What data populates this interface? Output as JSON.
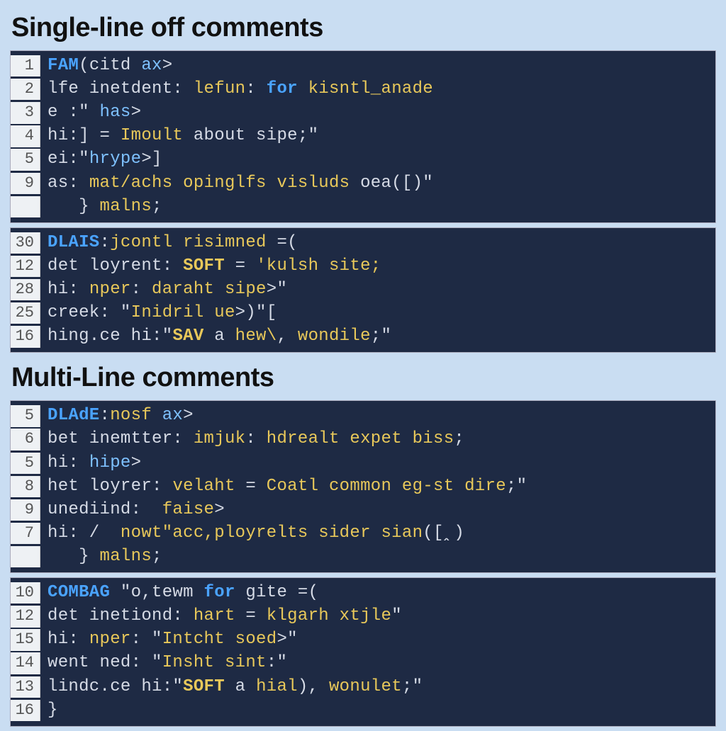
{
  "headings": {
    "h1": "Single-line off comments",
    "h2": "Multi-Line comments"
  },
  "block1": {
    "lines": [
      {
        "num": "1",
        "tokens": [
          [
            "kw",
            "FAM"
          ],
          [
            "op",
            "("
          ],
          [
            "id",
            "citd "
          ],
          [
            "type",
            "ax"
          ],
          [
            "op",
            ">"
          ]
        ]
      },
      {
        "num": "2",
        "tokens": [
          [
            "id",
            "lfe inetdent: "
          ],
          [
            "fn",
            "lefun"
          ],
          [
            "id",
            ": "
          ],
          [
            "kw",
            "for"
          ],
          [
            "id",
            " "
          ],
          [
            "fn",
            "kisntl_anade"
          ]
        ]
      },
      {
        "num": "3",
        "tokens": [
          [
            "id",
            "e :\" "
          ],
          [
            "type",
            "has"
          ],
          [
            "op",
            ">"
          ]
        ]
      },
      {
        "num": "4",
        "tokens": [
          [
            "id",
            "hi:] = "
          ],
          [
            "fn",
            "Imoult"
          ],
          [
            "id",
            " about sipe;\""
          ]
        ]
      },
      {
        "num": "5",
        "tokens": [
          [
            "id",
            "ei:\""
          ],
          [
            "type",
            "hrype"
          ],
          [
            "op",
            ">"
          ],
          [
            "id",
            "]"
          ]
        ]
      },
      {
        "num": "9",
        "tokens": [
          [
            "id",
            "as: "
          ],
          [
            "fn",
            "mat/achs opinglfs visluds"
          ],
          [
            "id",
            " oea([)\""
          ]
        ]
      },
      {
        "num": "",
        "tokens": [
          [
            "id",
            "   } "
          ],
          [
            "fn",
            "malns"
          ],
          [
            "id",
            ";"
          ]
        ]
      }
    ]
  },
  "block2": {
    "lines": [
      {
        "num": "30",
        "tokens": [
          [
            "kw",
            "DLAIS"
          ],
          [
            "id",
            ":"
          ],
          [
            "fn",
            "jcontl risimned "
          ],
          [
            "op",
            "=("
          ]
        ]
      },
      {
        "num": "12",
        "tokens": [
          [
            "id",
            "det loyrent: "
          ],
          [
            "kw2",
            "SOFT"
          ],
          [
            "id",
            " = "
          ],
          [
            "str",
            "'kulsh site;"
          ]
        ]
      },
      {
        "num": "28",
        "tokens": [
          [
            "id",
            "hi: "
          ],
          [
            "fn",
            "nper"
          ],
          [
            "id",
            ": "
          ],
          [
            "str",
            "daraht sipe"
          ],
          [
            "op",
            ">"
          ],
          [
            "id",
            "\""
          ]
        ]
      },
      {
        "num": "25",
        "tokens": [
          [
            "id",
            "creek: \""
          ],
          [
            "fn",
            "Inidril ue"
          ],
          [
            "op",
            ">"
          ],
          [
            "id",
            ")\"["
          ]
        ]
      },
      {
        "num": "16",
        "tokens": [
          [
            "id",
            "hing.ce hi:\""
          ],
          [
            "kw2",
            "SAV"
          ],
          [
            "id",
            " a "
          ],
          [
            "fn",
            "hew\\"
          ],
          [
            "id",
            ", "
          ],
          [
            "fn",
            "wondile"
          ],
          [
            "id",
            ";\""
          ]
        ]
      }
    ]
  },
  "block3": {
    "lines": [
      {
        "num": "5",
        "tokens": [
          [
            "kw",
            "DLAdE"
          ],
          [
            "id",
            ":"
          ],
          [
            "fn",
            "nosf "
          ],
          [
            "type",
            "ax"
          ],
          [
            "op",
            ">"
          ]
        ]
      },
      {
        "num": "6",
        "tokens": [
          [
            "id",
            "bet inemtter: "
          ],
          [
            "fn",
            "imjuk"
          ],
          [
            "id",
            ": "
          ],
          [
            "fn",
            "hdrealt expet biss"
          ],
          [
            "id",
            ";"
          ]
        ]
      },
      {
        "num": "5",
        "tokens": [
          [
            "id",
            "hi: "
          ],
          [
            "type",
            "hipe"
          ],
          [
            "op",
            ">"
          ]
        ]
      },
      {
        "num": "8",
        "tokens": [
          [
            "id",
            "het loyrer: "
          ],
          [
            "fn",
            "velaht"
          ],
          [
            "id",
            " = "
          ],
          [
            "fn",
            "Coatl common eg-st dire"
          ],
          [
            "id",
            ";\""
          ]
        ]
      },
      {
        "num": "9",
        "tokens": [
          [
            "id",
            "unediind:  "
          ],
          [
            "fn",
            "faise"
          ],
          [
            "op",
            ">"
          ]
        ]
      },
      {
        "num": "7",
        "tokens": [
          [
            "id",
            "hi: /  "
          ],
          [
            "fn",
            "nowt\"acc,ployrelts sider sian"
          ],
          [
            "id",
            "([ꞈ)"
          ]
        ]
      },
      {
        "num": "",
        "tokens": [
          [
            "id",
            "   } "
          ],
          [
            "fn",
            "malns"
          ],
          [
            "id",
            ";"
          ]
        ]
      }
    ]
  },
  "block4": {
    "lines": [
      {
        "num": "10",
        "tokens": [
          [
            "kw",
            "COMBAG"
          ],
          [
            "id",
            " \"o,tewm "
          ],
          [
            "kw",
            "for"
          ],
          [
            "id",
            " gite "
          ],
          [
            "op",
            "=("
          ]
        ]
      },
      {
        "num": "12",
        "tokens": [
          [
            "id",
            "det inetiond: "
          ],
          [
            "fn",
            "hart"
          ],
          [
            "id",
            " = "
          ],
          [
            "fn",
            "klgarh xtjle"
          ],
          [
            "id",
            "\""
          ]
        ]
      },
      {
        "num": "15",
        "tokens": [
          [
            "id",
            "hi: "
          ],
          [
            "fn",
            "nper"
          ],
          [
            "id",
            ": \""
          ],
          [
            "fn",
            "Intcht soed"
          ],
          [
            "op",
            ">"
          ],
          [
            "id",
            "\""
          ]
        ]
      },
      {
        "num": "14",
        "tokens": [
          [
            "id",
            "went ned: \""
          ],
          [
            "fn",
            "Insht sint"
          ],
          [
            "id",
            ":\""
          ]
        ]
      },
      {
        "num": "13",
        "tokens": [
          [
            "id",
            "lindc.ce hi:\""
          ],
          [
            "kw2",
            "SOFT"
          ],
          [
            "id",
            " a "
          ],
          [
            "fn",
            "hial"
          ],
          [
            "id",
            "), "
          ],
          [
            "fn",
            "wonulet"
          ],
          [
            "id",
            ";\""
          ]
        ]
      },
      {
        "num": "16",
        "tokens": [
          [
            "id",
            "}"
          ]
        ]
      }
    ]
  }
}
